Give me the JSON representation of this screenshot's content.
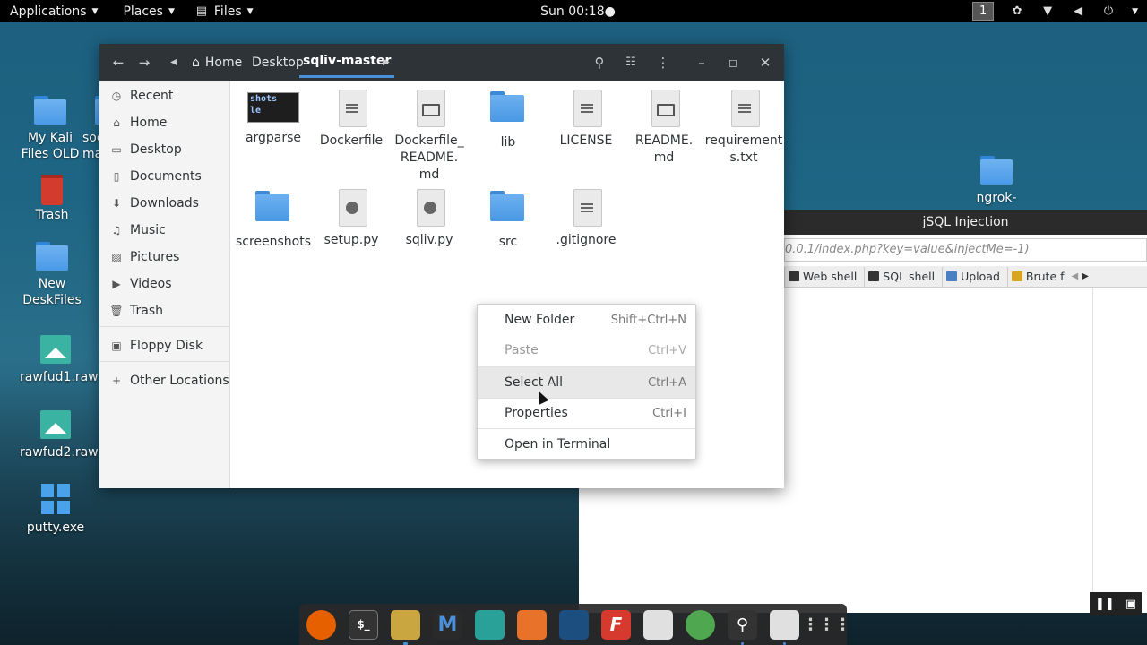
{
  "topbar": {
    "applications": "Applications",
    "places": "Places",
    "files": "Files",
    "clock": "Sun 00:18",
    "workspace": "1"
  },
  "desktop": {
    "icons": [
      {
        "label": "My Kali Files OLD",
        "type": "folder"
      },
      {
        "label": "soc ma",
        "type": "folder"
      },
      {
        "label": "Trash",
        "type": "trash"
      },
      {
        "label": "New DeskFiles",
        "type": "folder"
      },
      {
        "label": "rawfud1.raw",
        "type": "image"
      },
      {
        "label": "rawfud2.raw",
        "type": "image"
      },
      {
        "label": "putty.exe",
        "type": "windows-app"
      },
      {
        "label": "ngrok-",
        "type": "folder"
      }
    ]
  },
  "jsql": {
    "title": "jSQL Injection",
    "url": "0.0.1/index.php?key=value&injectMe=-1)",
    "tabs": [
      "Web shell",
      "SQL shell",
      "Upload",
      "Brute f"
    ]
  },
  "filemanager": {
    "breadcrumb": [
      "Home",
      "Desktop",
      "sqliv-master"
    ],
    "sidebar": [
      {
        "label": "Recent",
        "icon": "clock-icon"
      },
      {
        "label": "Home",
        "icon": "home-icon"
      },
      {
        "label": "Desktop",
        "icon": "desktop-icon"
      },
      {
        "label": "Documents",
        "icon": "document-icon"
      },
      {
        "label": "Downloads",
        "icon": "download-icon"
      },
      {
        "label": "Music",
        "icon": "music-icon"
      },
      {
        "label": "Pictures",
        "icon": "pictures-icon"
      },
      {
        "label": "Videos",
        "icon": "video-icon"
      },
      {
        "label": "Trash",
        "icon": "trash-icon"
      },
      {
        "label": "Floppy Disk",
        "icon": "floppy-icon"
      },
      {
        "label": "Other Locations",
        "icon": "plus-icon"
      }
    ],
    "files": [
      {
        "name": "argparse",
        "type": "terminal-thumb",
        "thumb": "shots\nle"
      },
      {
        "name": "Dockerfile",
        "type": "text"
      },
      {
        "name": "Dockerfile_ README. md",
        "type": "markdown"
      },
      {
        "name": "lib",
        "type": "folder"
      },
      {
        "name": "LICENSE",
        "type": "text"
      },
      {
        "name": "README. md",
        "type": "markdown"
      },
      {
        "name": "requirement s.txt",
        "type": "text"
      },
      {
        "name": "screenshots",
        "type": "folder"
      },
      {
        "name": "setup.py",
        "type": "python"
      },
      {
        "name": "sqliv.py",
        "type": "python"
      },
      {
        "name": "src",
        "type": "folder"
      },
      {
        "name": ".gitignore",
        "type": "text"
      }
    ]
  },
  "context_menu": {
    "items": [
      {
        "label": "New Folder",
        "accel": "Shift+Ctrl+N",
        "state": "normal"
      },
      {
        "label": "Paste",
        "accel": "Ctrl+V",
        "state": "disabled"
      },
      {
        "label": "Select All",
        "accel": "Ctrl+A",
        "state": "hover"
      },
      {
        "label": "Properties",
        "accel": "Ctrl+I",
        "state": "normal"
      },
      {
        "label": "Open in Terminal",
        "accel": "",
        "state": "normal"
      }
    ]
  },
  "dock": [
    {
      "name": "firefox",
      "color": "#e66000",
      "glyph": "",
      "state": "normal"
    },
    {
      "name": "terminal",
      "color": "#333333",
      "glyph": "$_",
      "state": "normal"
    },
    {
      "name": "files",
      "color": "#c9a640",
      "glyph": "",
      "state": "active"
    },
    {
      "name": "metasploit",
      "color": "#2a2a2a",
      "glyph": "M",
      "state": "normal"
    },
    {
      "name": "armitage",
      "color": "#2aa198",
      "glyph": "",
      "state": "normal"
    },
    {
      "name": "burpsuite",
      "color": "#e8722a",
      "glyph": "",
      "state": "normal"
    },
    {
      "name": "maltego",
      "color": "#1d4e80",
      "glyph": "",
      "state": "normal"
    },
    {
      "name": "faraday",
      "color": "#d63a2f",
      "glyph": "F",
      "state": "normal"
    },
    {
      "name": "leafpad",
      "color": "#e0e0e0",
      "glyph": "",
      "state": "normal"
    },
    {
      "name": "greenbone",
      "color": "#4fa84f",
      "glyph": "",
      "state": "normal"
    },
    {
      "name": "searchsploit",
      "color": "#333333",
      "glyph": "",
      "state": "running"
    },
    {
      "name": "jsql",
      "color": "#e0e0e0",
      "glyph": "",
      "state": "running"
    },
    {
      "name": "app-grid",
      "color": "#333333",
      "glyph": "",
      "state": "normal"
    }
  ]
}
